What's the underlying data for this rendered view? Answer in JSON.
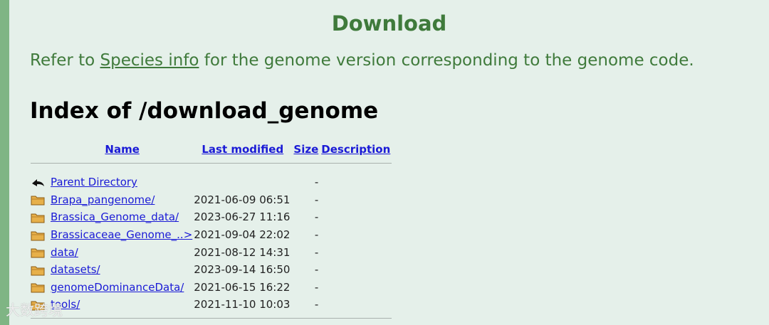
{
  "page": {
    "title": "Download",
    "refer_prefix": "Refer to ",
    "refer_link": "Species info",
    "refer_suffix": " for the genome version corresponding to the genome code.",
    "index_heading": "Index of /download_genome"
  },
  "table": {
    "headers": {
      "name": "Name",
      "last_modified": "Last modified",
      "size": "Size",
      "description": "Description"
    },
    "parent": {
      "name": "Parent Directory",
      "size": "-"
    },
    "rows": [
      {
        "name": "Brapa_pangenome/",
        "modified": "2021-06-09 06:51",
        "size": "-"
      },
      {
        "name": "Brassica_Genome_data/",
        "modified": "2023-06-27 11:16",
        "size": "-"
      },
      {
        "name": "Brassicaceae_Genome_..>",
        "modified": "2021-09-04 22:02",
        "size": "-"
      },
      {
        "name": "data/",
        "modified": "2021-08-12 14:31",
        "size": "-"
      },
      {
        "name": "datasets/",
        "modified": "2023-09-14 16:50",
        "size": "-"
      },
      {
        "name": "genomeDominanceData/",
        "modified": "2021-06-15 16:22",
        "size": "-"
      },
      {
        "name": "tools/",
        "modified": "2021-11-10 10:03",
        "size": "-"
      }
    ]
  },
  "watermark": "大数跨境",
  "colors": {
    "background": "#e5f0ea",
    "accent": "#3f7a3b",
    "left_bar": "#7fb584",
    "link": "#1a1ad6"
  },
  "icons": {
    "parent": "back-arrow-icon",
    "folder": "folder-icon"
  }
}
